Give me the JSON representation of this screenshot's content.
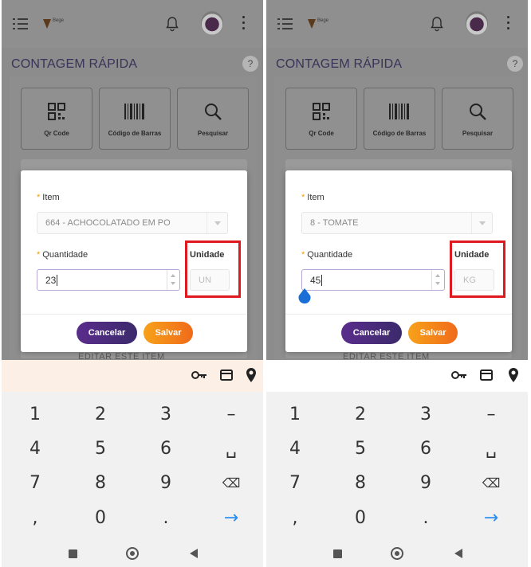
{
  "screens": [
    {
      "page_title": "CONTAGEM RÁPIDA",
      "help": "?",
      "scan_buttons": [
        {
          "label": "Qr Code",
          "icon": "qr-code-icon"
        },
        {
          "label": "Código de Barras",
          "icon": "barcode-icon"
        },
        {
          "label": "Pesquisar",
          "icon": "search-icon"
        }
      ],
      "modal": {
        "item_label": "Item",
        "item_value": "664 - ACHOCOLATADO EM PO",
        "quantity_label": "Quantidade",
        "quantity_value": "23",
        "unit_label": "Unidade",
        "unit_value": "UN",
        "cancel_label": "Cancelar",
        "save_label": "Salvar"
      },
      "edit_link": "EDITAR ESTE ITEM"
    },
    {
      "page_title": "CONTAGEM RÁPIDA",
      "help": "?",
      "scan_buttons": [
        {
          "label": "Qr Code",
          "icon": "qr-code-icon"
        },
        {
          "label": "Código de Barras",
          "icon": "barcode-icon"
        },
        {
          "label": "Pesquisar",
          "icon": "search-icon"
        }
      ],
      "modal": {
        "item_label": "Item",
        "item_value": "8 - TOMATE",
        "quantity_label": "Quantidade",
        "quantity_value": "45",
        "unit_label": "Unidade",
        "unit_value": "KG",
        "cancel_label": "Cancelar",
        "save_label": "Salvar"
      },
      "edit_link": "EDITAR ESTE ITEM"
    }
  ],
  "keyboard": {
    "toolbar_icons": [
      "key-icon",
      "card-icon",
      "location-icon"
    ],
    "rows": [
      [
        "1",
        "2",
        "3",
        "–"
      ],
      [
        "4",
        "5",
        "6",
        "␣"
      ],
      [
        "7",
        "8",
        "9",
        "⌫"
      ],
      [
        ",",
        "0",
        ".",
        "→"
      ]
    ]
  },
  "colors": {
    "primary": "#3b2a6b",
    "accent": "#f7a21a",
    "highlight": "#e0191f",
    "required": "#f5a000"
  }
}
